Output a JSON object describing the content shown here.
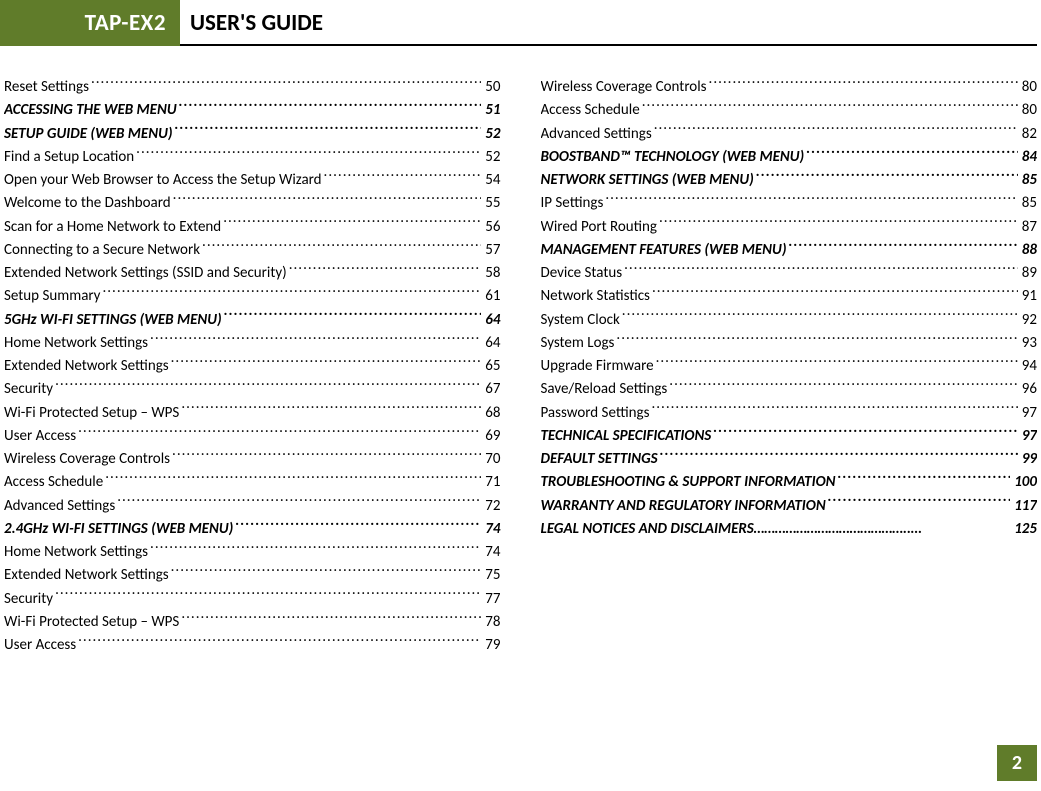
{
  "header": {
    "tab": "TAP-EX2",
    "title": "USER'S GUIDE"
  },
  "page_number": "2",
  "left": [
    {
      "label": "Reset Settings",
      "page": "50",
      "bold": false
    },
    {
      "label": "ACCESSING THE WEB MENU ",
      "page": "51",
      "bold": true
    },
    {
      "label": "SETUP GUIDE (WEB MENU)",
      "page": "52",
      "bold": true
    },
    {
      "label": "Find a Setup Location ",
      "page": "52",
      "bold": false
    },
    {
      "label": "Open your Web Browser to Access the Setup Wizard",
      "page": "54",
      "bold": false
    },
    {
      "label": "Welcome to the Dashboard ",
      "page": "55",
      "bold": false
    },
    {
      "label": "Scan for a Home Network to Extend ",
      "page": "56",
      "bold": false
    },
    {
      "label": "Connecting to a Secure Network ",
      "page": "57",
      "bold": false
    },
    {
      "label": "Extended Network Settings (SSID and Security) ",
      "page": "58",
      "bold": false
    },
    {
      "label": "Setup Summary ",
      "page": "61",
      "bold": false
    },
    {
      "label": "5GHz WI-FI SETTINGS (WEB MENU) ",
      "page": "64",
      "bold": true
    },
    {
      "label": "Home Network Settings  ",
      "page": "64",
      "bold": false
    },
    {
      "label": "Extended Network Settings  ",
      "page": "65",
      "bold": false
    },
    {
      "label": "Security ",
      "page": "67",
      "bold": false
    },
    {
      "label": "Wi-Fi Protected Setup – WPS  ",
      "page": "68",
      "bold": false
    },
    {
      "label": "User Access  ",
      "page": "69",
      "bold": false
    },
    {
      "label": "Wireless Coverage Controls ",
      "page": "70",
      "bold": false
    },
    {
      "label": "Access Schedule  ",
      "page": "71",
      "bold": false
    },
    {
      "label": "Advanced Settings  ",
      "page": "72",
      "bold": false
    },
    {
      "label": "2.4GHz WI-FI SETTINGS (WEB MENU)",
      "page": "74",
      "bold": true
    },
    {
      "label": "Home Network Settings  ",
      "page": "74",
      "bold": false
    },
    {
      "label": "Extended Network Settings  ",
      "page": "75",
      "bold": false
    },
    {
      "label": "Security ",
      "page": "77",
      "bold": false
    },
    {
      "label": "Wi-Fi Protected Setup – WPS  ",
      "page": "78",
      "bold": false
    },
    {
      "label": "User Access  ",
      "page": "79",
      "bold": false
    }
  ],
  "right": [
    {
      "label": "Wireless Coverage Controls  ",
      "page": "80",
      "bold": false
    },
    {
      "label": "Access Schedule  ",
      "page": "80",
      "bold": false
    },
    {
      "label": "Advanced Settings ",
      "page": "82",
      "bold": false
    },
    {
      "label": "BOOSTBAND™ TECHNOLOGY (WEB MENU) ",
      "page": "84",
      "bold": true
    },
    {
      "label": "NETWORK SETTINGS (WEB MENU)",
      "page": "85",
      "bold": true
    },
    {
      "label": "IP Settings ",
      "page": "85",
      "bold": false
    },
    {
      "label": "Wired Port Routing ",
      "page": "87",
      "bold": false
    },
    {
      "label": "MANAGEMENT FEATURES (WEB MENU) ",
      "page": "88",
      "bold": true
    },
    {
      "label": "Device Status ",
      "page": "89",
      "bold": false
    },
    {
      "label": "Network Statistics ",
      "page": "91",
      "bold": false
    },
    {
      "label": "System Clock ",
      "page": "92",
      "bold": false
    },
    {
      "label": "System Logs ",
      "page": "93",
      "bold": false
    },
    {
      "label": "Upgrade Firmware ",
      "page": "94",
      "bold": false
    },
    {
      "label": "Save/Reload Settings ",
      "page": "96",
      "bold": false
    },
    {
      "label": "Password Settings ",
      "page": "97",
      "bold": false
    },
    {
      "label": "TECHNICAL SPECIFICATIONS ",
      "page": "97",
      "bold": true
    },
    {
      "label": "DEFAULT SETTINGS ",
      "page": "99",
      "bold": true
    },
    {
      "label": "TROUBLESHOOTING & SUPPORT INFORMATION ",
      "page": "100",
      "bold": true
    },
    {
      "label": "WARRANTY AND REGULATORY INFORMATION ",
      "page": "117",
      "bold": true
    },
    {
      "label": "LEGAL NOTICES AND DISCLAIMERS ",
      "page": "125",
      "bold": true,
      "altdots": true
    }
  ]
}
